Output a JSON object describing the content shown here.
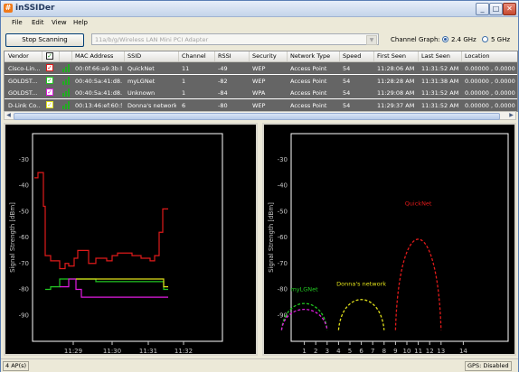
{
  "window": {
    "title": "inSSIDer"
  },
  "menu": [
    "File",
    "Edit",
    "View",
    "Help"
  ],
  "toolbar": {
    "scan_button": "Stop Scanning",
    "adapter": "11a/b/g/Wireless LAN Mini PCI Adapter",
    "channel_graph_label": "Channel Graph:",
    "band_24": "2.4 GHz",
    "band_5": "5 GHz",
    "selected_band": "2.4 GHz"
  },
  "table": {
    "columns": [
      "Vendor",
      "",
      "",
      "MAC Address",
      "SSID",
      "Channel",
      "RSSI",
      "Security",
      "Network Type",
      "Speed",
      "First Seen",
      "Last Seen",
      "Location"
    ],
    "rows": [
      {
        "vendor": "Cisco-Lin...",
        "color": "#e01a1a",
        "mac": "00:0f:66:a9:3b:b1",
        "ssid": "QuickNet",
        "channel": "11",
        "rssi": "-49",
        "security": "WEP",
        "type": "Access Point",
        "speed": "54",
        "first_seen": "11:28:06 AM",
        "last_seen": "11:31:52 AM",
        "location": "0.00000 , 0.00000"
      },
      {
        "vendor": "GOLDST...",
        "color": "#22c822",
        "mac": "00:40:5a:41:d8...",
        "ssid": "myLGNet",
        "channel": "1",
        "rssi": "-82",
        "security": "WEP",
        "type": "Access Point",
        "speed": "54",
        "first_seen": "11:28:28 AM",
        "last_seen": "11:31:38 AM",
        "location": "0.00000 , 0.00000"
      },
      {
        "vendor": "GOLDST...",
        "color": "#e01ae0",
        "mac": "00:40:5a:41:d8...",
        "ssid": "Unknown",
        "channel": "1",
        "rssi": "-84",
        "security": "WPA",
        "type": "Access Point",
        "speed": "54",
        "first_seen": "11:29:08 AM",
        "last_seen": "11:31:52 AM",
        "location": "0.00000 , 0.00000"
      },
      {
        "vendor": "D-Link Co...",
        "color": "#e0e01a",
        "mac": "00:13:46:ef:60:50",
        "ssid": "Donna's network",
        "channel": "6",
        "rssi": "-80",
        "security": "WEP",
        "type": "Access Point",
        "speed": "54",
        "first_seen": "11:29:37 AM",
        "last_seen": "11:31:52 AM",
        "location": "0.00000 , 0.00000"
      }
    ]
  },
  "time_graph": {
    "ylabel": "Signal Strength [dBm]",
    "yticks": [
      "-30",
      "-40",
      "-50",
      "-60",
      "-70",
      "-80",
      "-90"
    ],
    "xticks": [
      "11:29",
      "11:30",
      "11:31",
      "11:32"
    ]
  },
  "channel_graph": {
    "ylabel": "Signal Strength [dBm]",
    "yticks": [
      "-30",
      "-40",
      "-50",
      "-60",
      "-70",
      "-80",
      "-90"
    ],
    "xticks": [
      "1",
      "2",
      "3",
      "4",
      "5",
      "6",
      "7",
      "8",
      "9",
      "10",
      "11",
      "12",
      "13",
      "14"
    ],
    "labels": [
      {
        "text": "QuickNet",
        "color": "#e01a1a",
        "channel": 11,
        "rssi": -49
      },
      {
        "text": "myLGNet",
        "color": "#22c822",
        "channel": 1,
        "rssi": -82
      },
      {
        "text": "Donna's network",
        "color": "#e0e01a",
        "channel": 6,
        "rssi": -80
      }
    ]
  },
  "status": {
    "ap_count": "4 AP(s)",
    "gps": "GPS: Disabled"
  }
}
